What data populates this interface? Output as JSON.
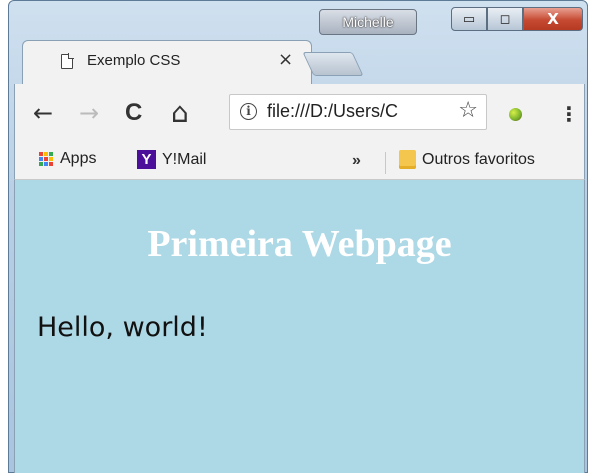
{
  "window": {
    "user_name": "Michelle",
    "controls": {
      "minimize": "▭",
      "maximize": "◻",
      "close": "X"
    }
  },
  "tab": {
    "title": "Exemplo CSS",
    "close": "×"
  },
  "toolbar": {
    "back": "←",
    "forward": "→",
    "reload": "C",
    "home": "⌂",
    "url": "file:///D:/Users/C",
    "info": "i",
    "star": "☆",
    "menu": "⋮"
  },
  "bookmarks": {
    "apps_label": "Apps",
    "ymail_label": "Y!Mail",
    "ymail_icon": "Y",
    "more": "»",
    "other_label": "Outros favoritos"
  },
  "page": {
    "heading": "Primeira Webpage",
    "paragraph": "Hello, world!",
    "background_color": "#add8e6",
    "heading_color": "#ffffff"
  },
  "icons": {
    "apps_grid_colors": [
      "#ea4335",
      "#fbbc05",
      "#34a853",
      "#4285f4",
      "#ea4335",
      "#fbbc05",
      "#34a853",
      "#4285f4",
      "#ea4335"
    ]
  }
}
